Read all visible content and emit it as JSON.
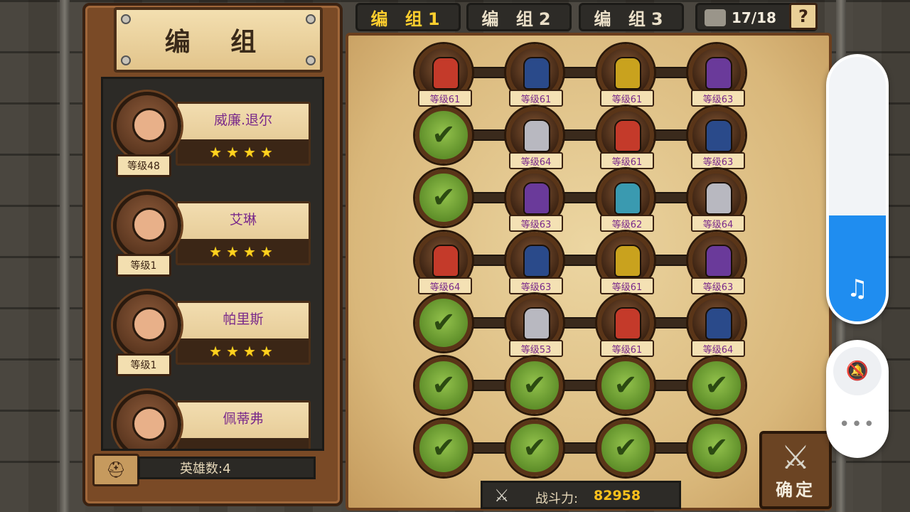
{
  "left_panel": {
    "title": "编 组",
    "heroes": [
      {
        "name": "威廉.退尔",
        "level": "等级48",
        "stars": "★★★★"
      },
      {
        "name": "艾琳",
        "level": "等级1",
        "stars": "★★★★"
      },
      {
        "name": "帕里斯",
        "level": "等级1",
        "stars": "★★★★"
      },
      {
        "name": "佩蒂弗",
        "level": "",
        "stars": ""
      }
    ],
    "hero_count": "英雄数:4"
  },
  "tabs": [
    {
      "label": "编 组1",
      "active": true
    },
    {
      "label": "编 组2",
      "active": false
    },
    {
      "label": "编 组3",
      "active": false
    }
  ],
  "team_counter": "17/18",
  "help_label": "?",
  "board": {
    "rows": [
      [
        "等级61",
        "等级61",
        "等级61",
        "等级63"
      ],
      [
        "",
        "等级64",
        "等级61",
        "等级63"
      ],
      [
        "",
        "等级63",
        "等级62",
        "等级64"
      ],
      [
        "等级64",
        "等级63",
        "等级61",
        "等级63"
      ],
      [
        "",
        "等级53",
        "等级61",
        "等级64"
      ],
      [
        "",
        "",
        "",
        ""
      ],
      [
        "",
        "",
        "",
        ""
      ]
    ],
    "check_glyph": "✔"
  },
  "power": {
    "label": "战斗力:",
    "value": "82958"
  },
  "confirm_label": "确定",
  "system_overlay": {
    "volume_level": 0.4,
    "music_icon": "music-note-icon",
    "ringer_icon": "bell-off-icon",
    "more_icon": "more-dots-icon"
  },
  "colors": {
    "accent_gold": "#ffcf2e",
    "check_green": "#7fb03c",
    "level_purple": "#7a2a8a",
    "volume_blue": "#1f8df0"
  }
}
